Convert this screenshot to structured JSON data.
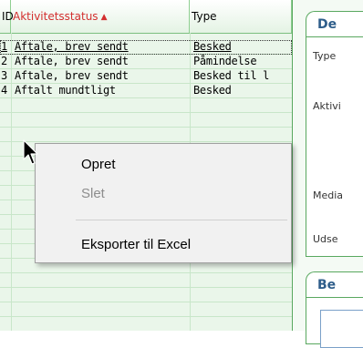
{
  "grid": {
    "columns": [
      {
        "label": "ID",
        "sorted": false
      },
      {
        "label": "Aktivitetsstatus",
        "sorted": true,
        "sort_icon": "sort-ascending-icon",
        "sort_glyph": "▲"
      },
      {
        "label": "Type",
        "sorted": false
      }
    ],
    "rows": [
      {
        "id": "1",
        "status": "Aftale, brev sendt",
        "type": "Besked",
        "selected": true
      },
      {
        "id": "2",
        "status": "Aftale, brev sendt",
        "type": "Påmindelse",
        "selected": false
      },
      {
        "id": "3",
        "status": "Aftale, brev sendt",
        "type": "Besked til l",
        "selected": false
      },
      {
        "id": "4",
        "status": "Aftalt mundtligt",
        "type": "Besked",
        "selected": false
      }
    ]
  },
  "detail": {
    "tab1_label": "De",
    "tab2_label": "Be",
    "fields": [
      "Type",
      "Aktivi",
      "Media",
      "Udse"
    ]
  },
  "context_menu": {
    "items": [
      {
        "label": "Opret",
        "enabled": true
      },
      {
        "label": "Slet",
        "enabled": false
      },
      {
        "label": "Eksporter til Excel",
        "enabled": true
      }
    ]
  },
  "colors": {
    "grid_border": "#59a85f",
    "sorted_header": "#d32f2f",
    "tab_text": "#2e5d8a",
    "disabled_text": "#8d8d8d"
  }
}
